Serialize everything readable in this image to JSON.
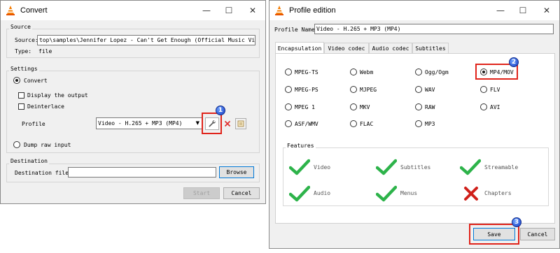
{
  "convert": {
    "title": "Convert",
    "source_group": "Source",
    "source_label": "Source:",
    "source_value": "top\\samples\\Jennifer Lopez - Can't Get Enough (Official Music Video).mpeg",
    "type_label": "Type:",
    "type_value": "file",
    "settings_group": "Settings",
    "convert_option": "Convert",
    "display_output": "Display the output",
    "deinterlace": "Deinterlace",
    "profile_label": "Profile",
    "profile_value": "Video - H.265 + MP3 (MP4)",
    "dump_raw": "Dump raw input",
    "destination_group": "Destination",
    "destination_label": "Destination file:",
    "destination_value": "",
    "browse": "Browse",
    "start": "Start",
    "cancel": "Cancel",
    "badge": "1"
  },
  "profile": {
    "title": "Profile edition",
    "name_label": "Profile Name",
    "name_value": "Video - H.265 + MP3 (MP4)",
    "tabs": [
      "Encapsulation",
      "Video codec",
      "Audio codec",
      "Subtitles"
    ],
    "formats": [
      "MPEG-TS",
      "Webm",
      "Ogg/Ogm",
      "MP4/MOV",
      "MPEG-PS",
      "MJPEG",
      "WAV",
      "FLV",
      "MPEG 1",
      "MKV",
      "RAW",
      "AVI",
      "ASF/WMV",
      "FLAC",
      "MP3"
    ],
    "selected": "MP4/MOV",
    "features_group": "Features",
    "features": [
      {
        "label": "Video",
        "enabled": true
      },
      {
        "label": "Subtitles",
        "enabled": true
      },
      {
        "label": "Streamable",
        "enabled": true
      },
      {
        "label": "Audio",
        "enabled": true
      },
      {
        "label": "Menus",
        "enabled": true
      },
      {
        "label": "Chapters",
        "enabled": false
      }
    ],
    "save": "Save",
    "cancel": "Cancel",
    "badge_format": "2",
    "badge_save": "3"
  },
  "window_controls": {
    "minimize": "—",
    "maximize": "☐",
    "close": "✕"
  },
  "colors": {
    "highlight": "#e0241b",
    "badge": "#1a3fc4",
    "check": "#2db34a",
    "cross": "#d0201a"
  }
}
